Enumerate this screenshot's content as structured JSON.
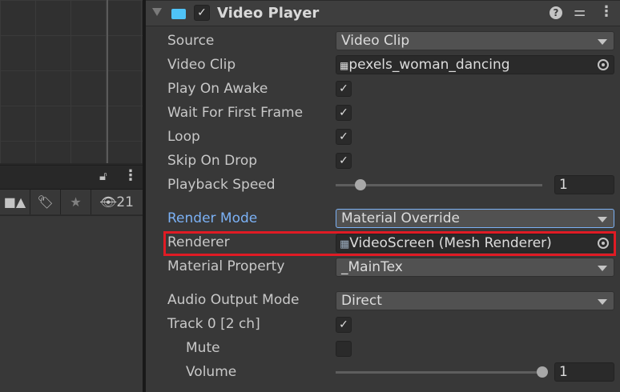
{
  "component": {
    "title": "Video Player",
    "enabled": true
  },
  "hierarchy": {
    "visibility_count": "21"
  },
  "fields": {
    "source": {
      "label": "Source",
      "value": "Video Clip"
    },
    "video_clip": {
      "label": "Video Clip",
      "value": "pexels_woman_dancing"
    },
    "play_on_awake": {
      "label": "Play On Awake",
      "checked": true
    },
    "wait_first_frame": {
      "label": "Wait For First Frame",
      "checked": true
    },
    "loop": {
      "label": "Loop",
      "checked": true
    },
    "skip_on_drop": {
      "label": "Skip On Drop",
      "checked": true
    },
    "playback_speed": {
      "label": "Playback Speed",
      "value": "1",
      "slider_fraction": 0.12
    },
    "render_mode": {
      "label": "Render Mode",
      "value": "Material Override"
    },
    "renderer": {
      "label": "Renderer",
      "value": "VideoScreen (Mesh Renderer)"
    },
    "material_property": {
      "label": "Material Property",
      "value": "_MainTex"
    },
    "audio_output_mode": {
      "label": "Audio Output Mode",
      "value": "Direct"
    },
    "track0": {
      "label": "Track 0 [2 ch]",
      "checked": true
    },
    "mute": {
      "label": "Mute",
      "checked": false
    },
    "volume": {
      "label": "Volume",
      "value": "1",
      "slider_fraction": 1.0
    }
  },
  "colors": {
    "accent": "#7bb1f5",
    "highlight": "#e01b24",
    "icon": "#4fc3f7"
  }
}
